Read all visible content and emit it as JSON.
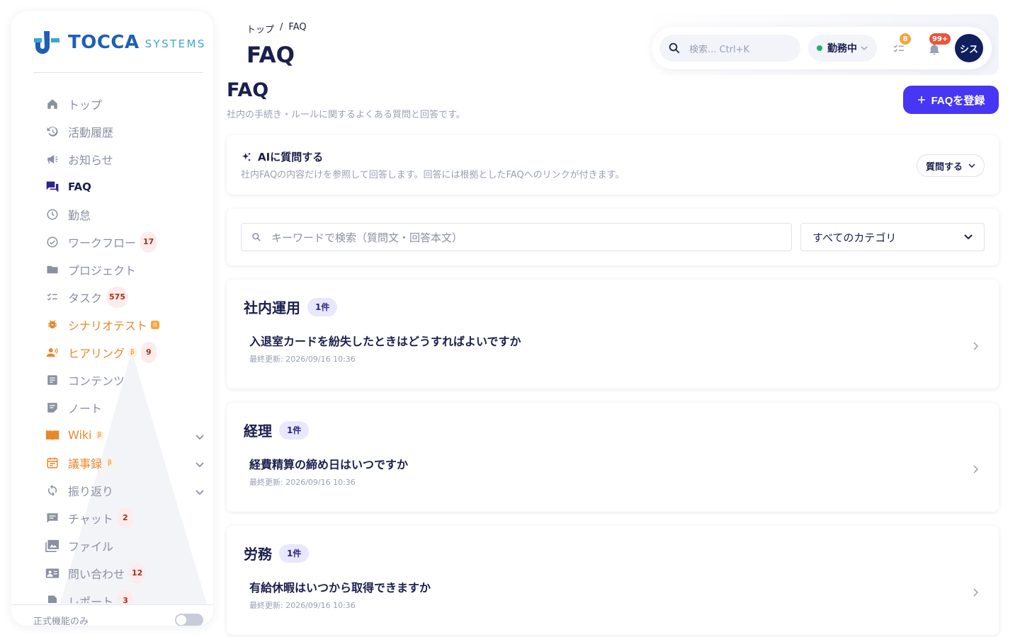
{
  "brand": {
    "name": "TOCCA",
    "sub": "SYSTEMS"
  },
  "sidebar": {
    "items": [
      {
        "label": "トップ",
        "icon": "home-icon"
      },
      {
        "label": "活動履歴",
        "icon": "history-icon"
      },
      {
        "label": "お知らせ",
        "icon": "megaphone-icon"
      },
      {
        "label": "FAQ",
        "icon": "forum-icon",
        "active": true
      },
      {
        "label": "勤怠",
        "icon": "clock-icon"
      },
      {
        "label": "ワークフロー",
        "icon": "check-circle-icon",
        "badge": "17"
      },
      {
        "label": "プロジェクト",
        "icon": "folder-icon"
      },
      {
        "label": "タスク",
        "icon": "checklist-icon",
        "badge": "575"
      },
      {
        "label": "シナリオテスト",
        "icon": "bug-icon",
        "tag": "α",
        "orange": true
      },
      {
        "label": "ヒアリング",
        "icon": "interview-icon",
        "tag": "β",
        "badge": "9",
        "orange": true
      },
      {
        "label": "コンテンツ",
        "icon": "article-icon"
      },
      {
        "label": "ノート",
        "icon": "note-icon"
      },
      {
        "label": "Wiki",
        "icon": "book-icon",
        "tag": "β",
        "orange": true,
        "expand": true
      },
      {
        "label": "議事録",
        "icon": "calendar-icon",
        "tag": "β",
        "orange": true,
        "expand": true
      },
      {
        "label": "振り返り",
        "icon": "refresh-icon",
        "expand": true
      },
      {
        "label": "チャット",
        "icon": "chat-icon",
        "badge": "2"
      },
      {
        "label": "ファイル",
        "icon": "photo-library-icon"
      },
      {
        "label": "問い合わせ",
        "icon": "contact-card-icon",
        "badge": "12"
      },
      {
        "label": "レポート",
        "icon": "report-icon",
        "badge": "3"
      }
    ],
    "footer_label": "正式機能のみ"
  },
  "header": {
    "breadcrumb": [
      "トップ",
      "/",
      "FAQ"
    ],
    "title": "FAQ",
    "search_placeholder": "検索... Ctrl+K",
    "status_label": "勤務中",
    "tasks_badge": "8",
    "notifications_badge": "99+",
    "avatar_text": "シス"
  },
  "main": {
    "title": "FAQ",
    "description": "社内の手続き・ルールに関するよくある質問と回答です。",
    "add_button": "FAQを登録",
    "ai": {
      "title": "AIに質問する",
      "description": "社内FAQの内容だけを参照して回答します。回答には根拠としたFAQへのリンクが付きます。",
      "button": "質問する"
    },
    "filter": {
      "keyword_placeholder": "キーワードで検索（質問文・回答本文）",
      "category_value": "すべてのカテゴリ"
    },
    "sections": [
      {
        "name": "社内運用",
        "count": "1件",
        "faqs": [
          {
            "question": "入退室カードを紛失したときはどうすればよいですか",
            "meta": "最終更新: 2026/09/16 10:36"
          }
        ]
      },
      {
        "name": "経理",
        "count": "1件",
        "faqs": [
          {
            "question": "経費精算の締め日はいつですか",
            "meta": "最終更新: 2026/09/16 10:36"
          }
        ]
      },
      {
        "name": "労務",
        "count": "1件",
        "faqs": [
          {
            "question": "有給休暇はいつから取得できますか",
            "meta": "最終更新: 2026/09/16 10:36"
          }
        ]
      }
    ]
  },
  "colors": {
    "accent": "#4736f3",
    "navy": "#1b1f4e",
    "orange": "#e8872c",
    "green": "#1fb36b",
    "badge_orange": "#f4a53d",
    "badge_red": "#e8553e"
  }
}
